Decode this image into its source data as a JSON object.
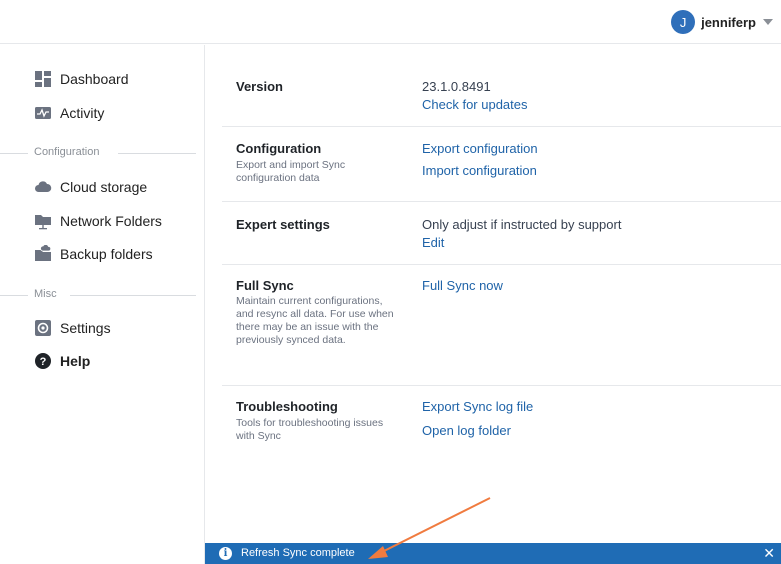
{
  "user": {
    "initial": "J",
    "name": "jenniferp"
  },
  "sidebar": {
    "items": [
      {
        "label": "Dashboard",
        "icon": "dashboard-icon"
      },
      {
        "label": "Activity",
        "icon": "activity-icon"
      }
    ],
    "section_config": "Configuration",
    "config_items": [
      {
        "label": "Cloud storage",
        "icon": "cloud-icon"
      },
      {
        "label": "Network Folders",
        "icon": "network-folder-icon"
      },
      {
        "label": "Backup folders",
        "icon": "backup-folder-icon"
      }
    ],
    "section_misc": "Misc",
    "misc_items": [
      {
        "label": "Settings",
        "icon": "gear-icon"
      },
      {
        "label": "Help",
        "icon": "help-icon"
      }
    ]
  },
  "main": {
    "version": {
      "title": "Version",
      "value": "23.1.0.8491",
      "link": "Check for updates"
    },
    "configuration": {
      "title": "Configuration",
      "desc": "Export and import Sync configuration data",
      "link1": "Export configuration",
      "link2": "Import configuration"
    },
    "expert": {
      "title": "Expert settings",
      "value": "Only adjust if instructed by support",
      "link": "Edit"
    },
    "fullsync": {
      "title": "Full Sync",
      "desc": "Maintain current configurations, and resync all data. For use when there may be an issue with the previously synced data.",
      "link": "Full Sync now"
    },
    "troubleshooting": {
      "title": "Troubleshooting",
      "desc": "Tools for troubleshooting issues with Sync",
      "link1": "Export Sync log file",
      "link2": "Open log folder"
    }
  },
  "banner": {
    "message": "Refresh Sync complete",
    "close": "✕",
    "info": "i"
  },
  "colors": {
    "accent": "#1f6cb5",
    "link": "#1f63a8",
    "avatar": "#2f6fba",
    "arrow": "#f07b3f"
  }
}
